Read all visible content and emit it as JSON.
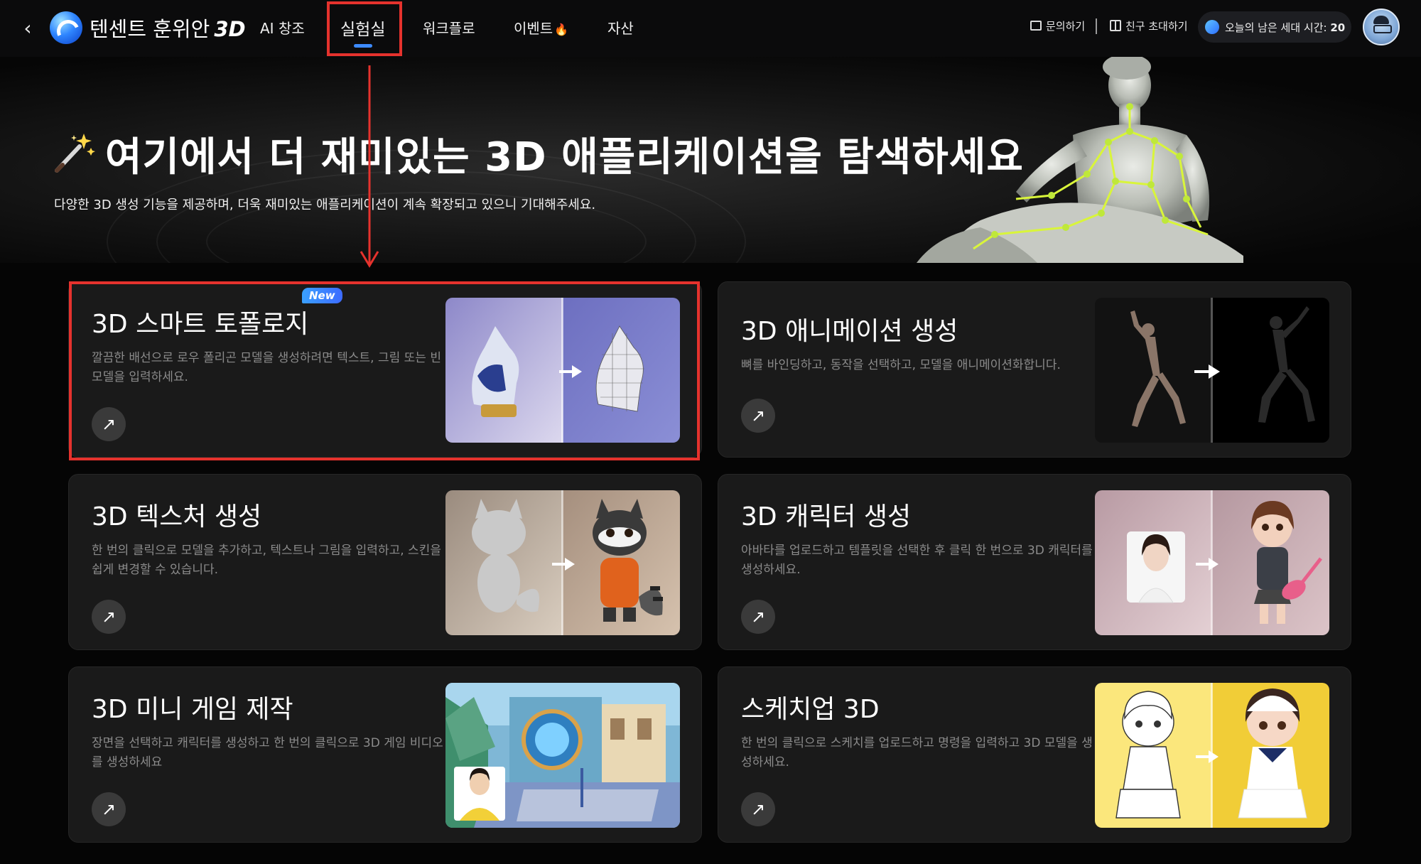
{
  "nav": {
    "back_label": "‹",
    "brand": "텐센트 훈위안",
    "brand_3d": "3D",
    "items": [
      {
        "label": "AI 창조"
      },
      {
        "label": "실험실"
      },
      {
        "label": "워크플로"
      },
      {
        "label": "이벤트"
      },
      {
        "label": "자산"
      }
    ],
    "contact": "문의하기",
    "invite": "친구 초대하기",
    "quota_label": "오늘의 남은 세대 시간:",
    "quota_value": "20"
  },
  "hero": {
    "title": "여기에서 더 재미있는 3D 애플리케이션을 탐색하세요",
    "subtitle": "다양한 3D 생성 기능을 제공하며, 더욱 재미있는 애플리케이션이 계속 확장되고 있으니 기대해주세요."
  },
  "cards": [
    {
      "title": "3D 스마트 토폴로지",
      "badge": "New",
      "desc": "깔끔한 배선으로 로우 폴리곤 모델을 생성하려면 텍스트, 그림 또는 빈 모델을 입력하세요.",
      "action": "↗"
    },
    {
      "title": "3D 애니메이션 생성",
      "desc": "뼈를 바인딩하고, 동작을 선택하고, 모델을 애니메이션화합니다.",
      "action": "↗"
    },
    {
      "title": "3D 텍스처 생성",
      "desc": "한 번의 클릭으로 모델을 추가하고, 텍스트나 그림을 입력하고, 스킨을 쉽게 변경할 수 있습니다.",
      "action": "↗"
    },
    {
      "title": "3D 캐릭터 생성",
      "desc": "아바타를 업로드하고 템플릿을 선택한 후 클릭 한 번으로 3D 캐릭터를 생성하세요.",
      "action": "↗"
    },
    {
      "title": "3D 미니 게임 제작",
      "desc": "장면을 선택하고 캐릭터를 생성하고 한 번의 클릭으로 3D 게임 비디오를 생성하세요",
      "action": "↗"
    },
    {
      "title": "스케치업 3D",
      "desc": "한 번의 클릭으로 스케치를 업로드하고 명령을 입력하고 3D 모델을 생성하세요.",
      "action": "↗"
    }
  ],
  "colors": {
    "accent": "#3d8bff",
    "annotation": "#e5322d",
    "card_bg": "#1a1a1a"
  },
  "icons": [
    "back-arrow-icon",
    "brand-logo-icon",
    "fire-icon",
    "mail-icon",
    "gift-icon",
    "quota-icon",
    "wand-icon",
    "arrow-up-right-icon"
  ]
}
